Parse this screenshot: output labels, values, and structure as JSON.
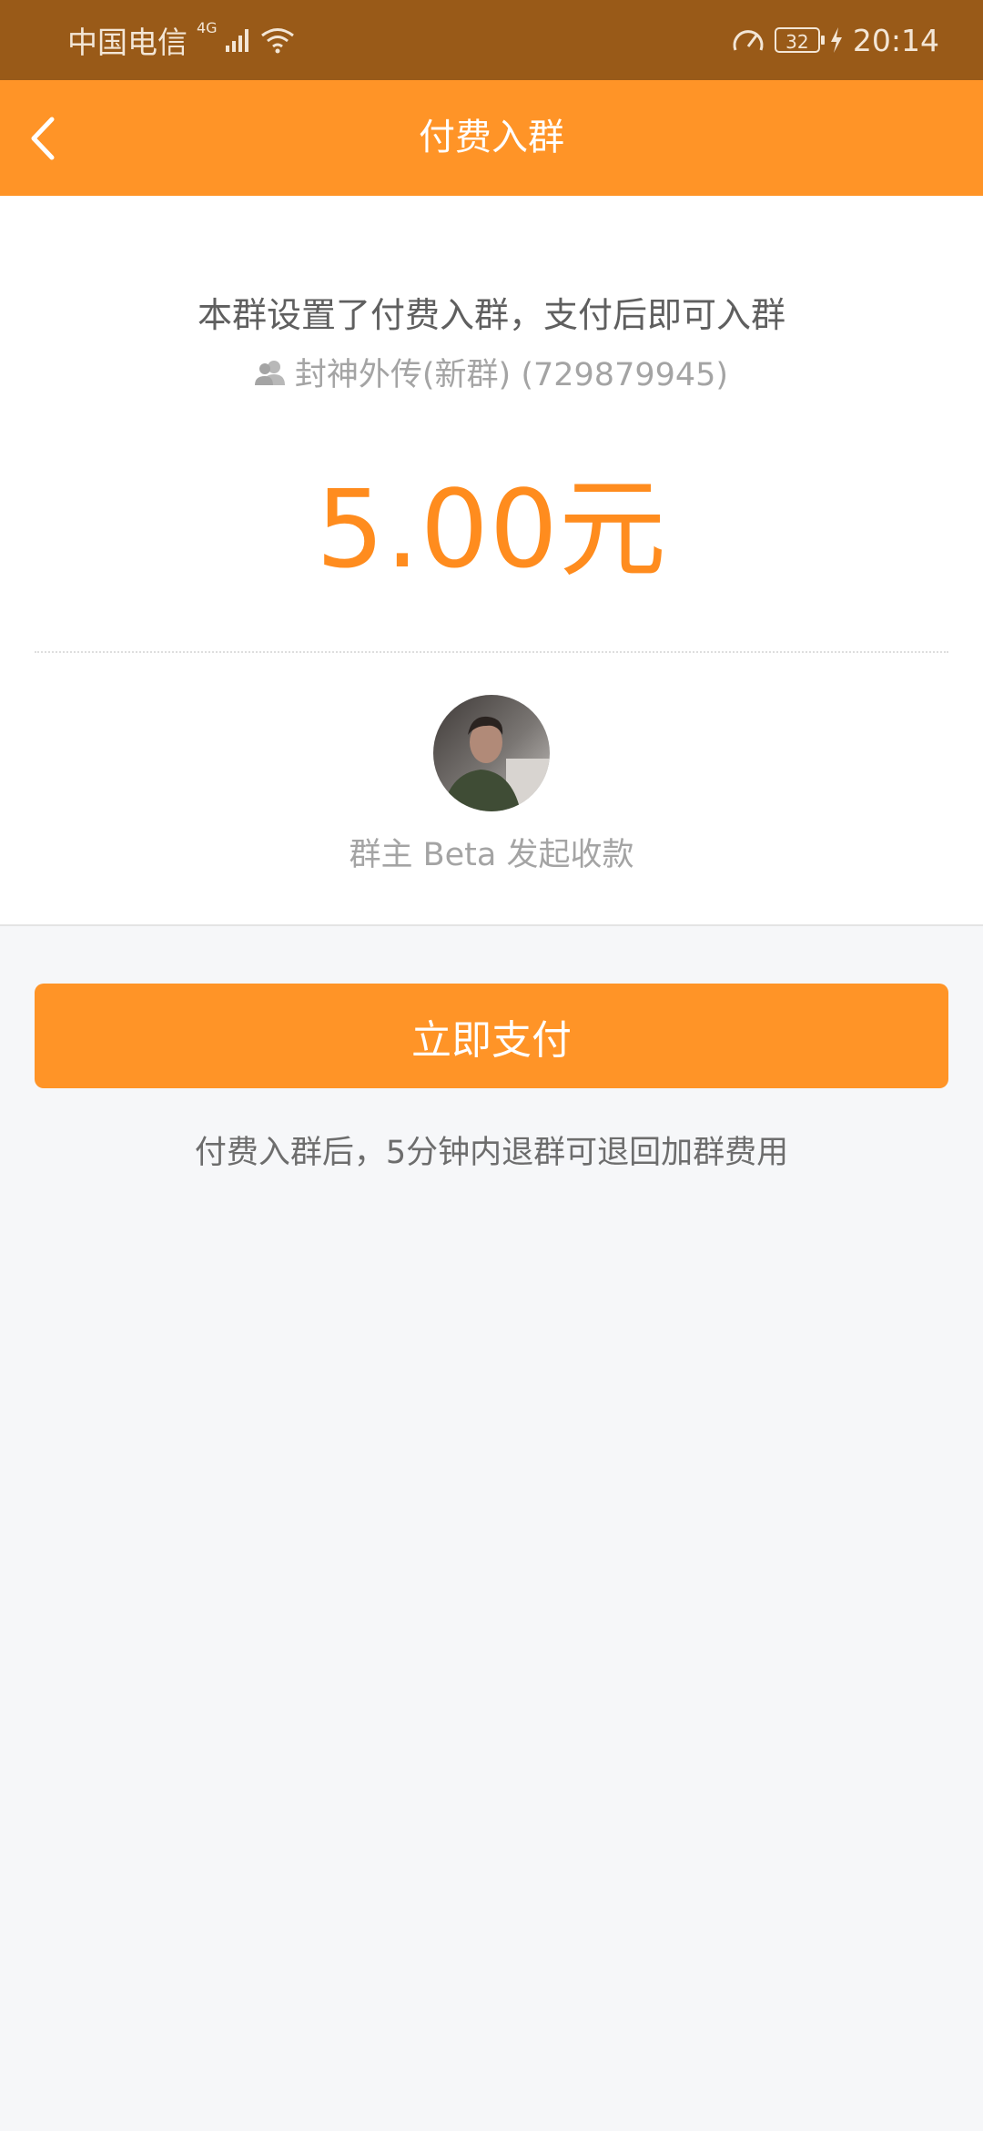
{
  "status_bar": {
    "carrier": "中国电信",
    "network": "4G",
    "battery": "32",
    "time": "20:14",
    "icons": [
      "signal-icon",
      "wifi-icon",
      "speed-icon",
      "battery-icon",
      "charging-icon"
    ]
  },
  "nav": {
    "title": "付费入群",
    "back_icon": "back-arrow-icon"
  },
  "main": {
    "intro": "本群设置了付费入群，支付后即可入群",
    "group_name": "封神外传(新群) (729879945)",
    "group_icon": "group-members-icon",
    "price": "5.00元",
    "owner_text": "群主 Beta 发起收款"
  },
  "actions": {
    "pay_label": "立即支付"
  },
  "footer": {
    "note": "付费入群后，5分钟内退群可退回加群费用"
  },
  "colors": {
    "status_bar": "#995a18",
    "accent": "#ff9427",
    "price": "#ff8c1e",
    "background": "#f6f7f9"
  }
}
